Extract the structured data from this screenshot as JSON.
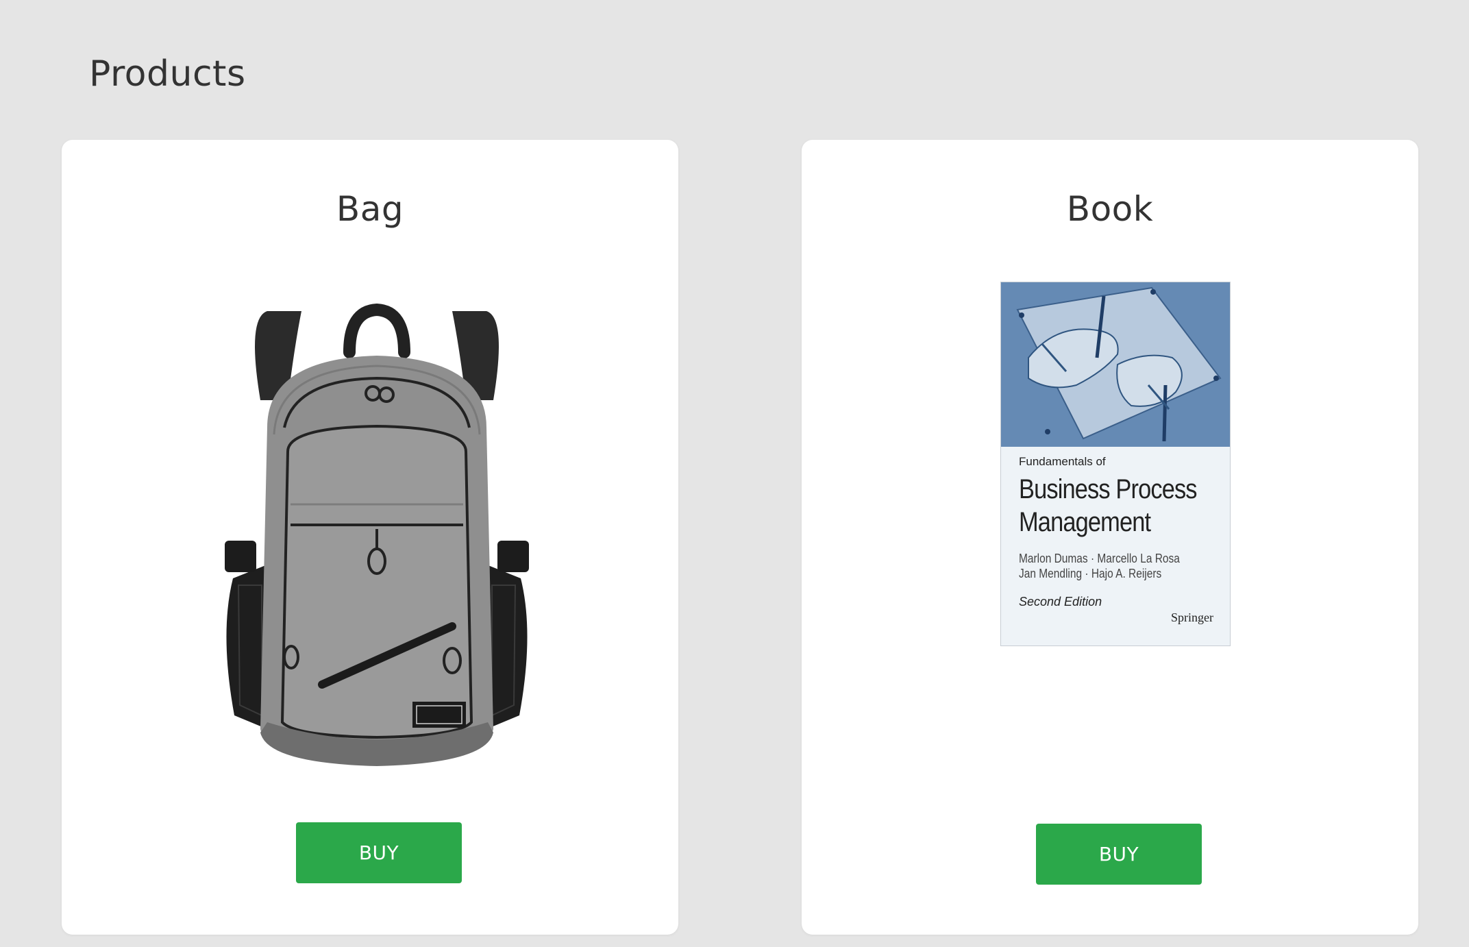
{
  "page": {
    "title": "Products"
  },
  "products": [
    {
      "name": "Bag",
      "image_icon": "backpack-image",
      "buy_label": "BUY"
    },
    {
      "name": "Book",
      "image_icon": "book-cover-image",
      "buy_label": "BUY",
      "cover": {
        "subtitle": "Fundamentals of",
        "title_line_1": "Business Process",
        "title_line_2": "Management",
        "authors_line_1": "Marlon Dumas · Marcello La Rosa",
        "authors_line_2": "Jan Mendling · Hajo A. Reijers",
        "edition": "Second Edition",
        "publisher": "Springer"
      }
    }
  ],
  "colors": {
    "background": "#e5e5e5",
    "card": "#ffffff",
    "buy_button": "#2ba84a",
    "text": "#333333"
  }
}
